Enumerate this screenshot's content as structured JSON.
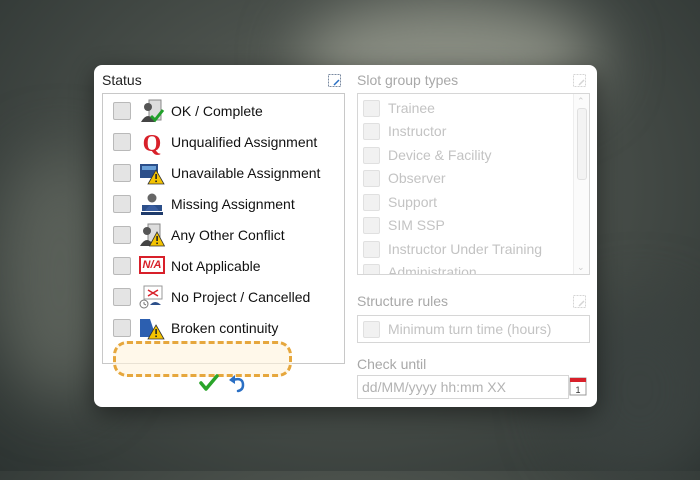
{
  "status_panel": {
    "title": "Status",
    "items": [
      {
        "label": "OK / Complete",
        "icon": "ok-complete-icon"
      },
      {
        "label": "Unqualified Assignment",
        "icon": "q-letter-icon"
      },
      {
        "label": "Unavailable Assignment",
        "icon": "unavailable-warning-icon"
      },
      {
        "label": "Missing Assignment",
        "icon": "missing-person-icon"
      },
      {
        "label": "Any Other Conflict",
        "icon": "conflict-warning-icon"
      },
      {
        "label": "Not Applicable",
        "icon": "n-a-badge-icon",
        "badge": "N/A"
      },
      {
        "label": "No Project / Cancelled",
        "icon": "no-project-icon"
      },
      {
        "label": "Broken continuity",
        "icon": "broken-continuity-icon"
      }
    ],
    "highlight_color": "#e6a73d"
  },
  "slot_group_types": {
    "title": "Slot group types",
    "items": [
      "Trainee",
      "Instructor",
      "Device & Facility",
      "Observer",
      "Support",
      "SIM SSP",
      "Instructor Under Training",
      "Administration"
    ]
  },
  "structure_rules": {
    "title": "Structure rules",
    "items": [
      "Minimum turn time (hours)"
    ]
  },
  "check_until": {
    "title": "Check until",
    "placeholder": "dd/MM/yyyy hh:mm XX"
  },
  "colors": {
    "accept_green": "#2aa52a",
    "undo_blue": "#2a6fc4",
    "q_red": "#d8202a",
    "warning_yellow": "#f4c300"
  }
}
